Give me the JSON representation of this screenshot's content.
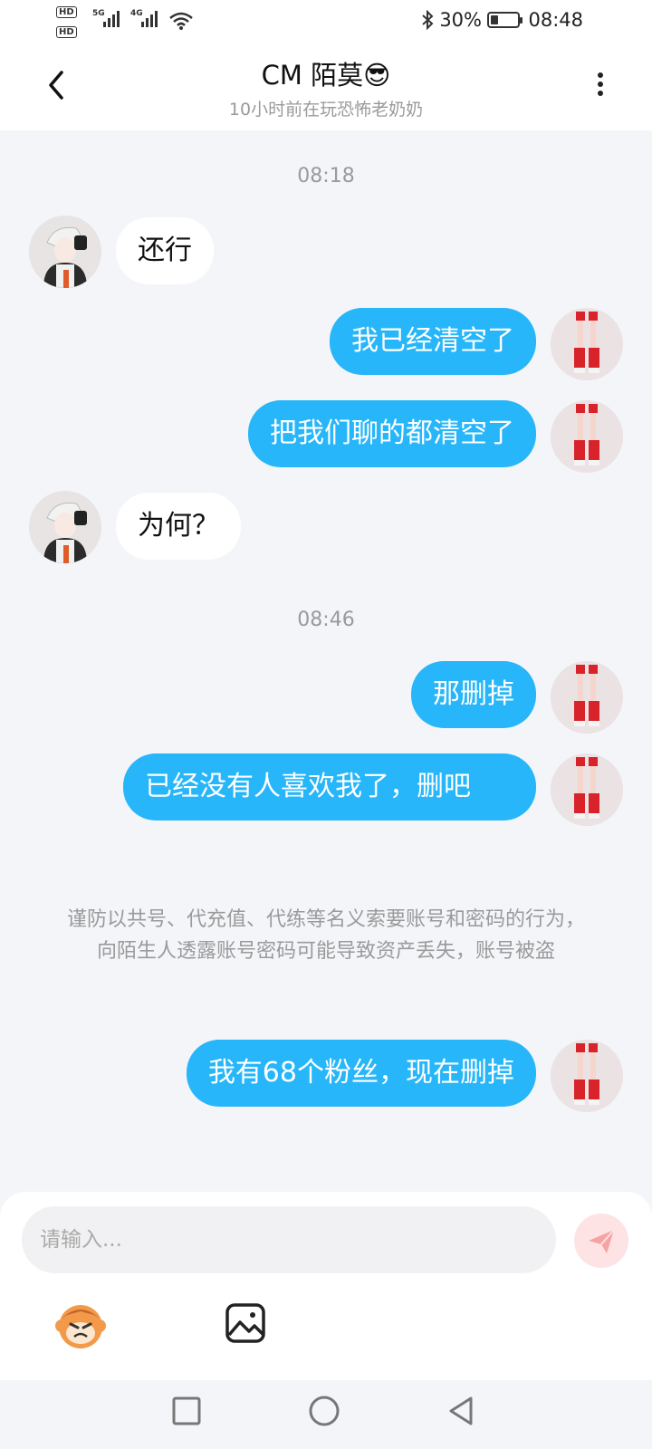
{
  "status_bar": {
    "hd_badges": [
      "HD",
      "HD"
    ],
    "sim_labels": [
      "5G",
      "4G"
    ],
    "battery_level": 0.3,
    "battery_text": "30%",
    "time": "08:48"
  },
  "header": {
    "title": "CM 陌莫😎",
    "subtitle": "10小时前在玩恐怖老奶奶"
  },
  "chat": {
    "timestamps": [
      "08:18",
      "08:46"
    ],
    "messages": [
      {
        "side": "them",
        "text": "还行"
      },
      {
        "side": "me",
        "text": "我已经清空了"
      },
      {
        "side": "me",
        "text": "把我们聊的都清空了"
      },
      {
        "side": "them",
        "text": "为何？"
      },
      {
        "side": "me",
        "text": "那删掉"
      },
      {
        "side": "me",
        "text": "已经没有人喜欢我了，删吧"
      },
      {
        "side": "me",
        "text": "我有68个粉丝，现在删掉"
      }
    ],
    "notice": "谨防以共号、代充值、代练等名义索要账号和密码的行为，向陌生人透露账号密码可能导致资产丢失，账号被盗"
  },
  "input_bar": {
    "placeholder": "请输入...",
    "value": "",
    "icons": [
      "send-icon",
      "emoji-icon",
      "image-icon"
    ]
  },
  "nav_bar": {
    "icons": [
      "recent-apps-icon",
      "home-icon",
      "back-triangle-icon"
    ]
  },
  "colors": {
    "bubble_me": "#27b6f9",
    "bubble_them": "#ffffff",
    "background": "#f4f5f9",
    "send_button": "#fde3e3",
    "send_icon": "#f5a3a3"
  }
}
